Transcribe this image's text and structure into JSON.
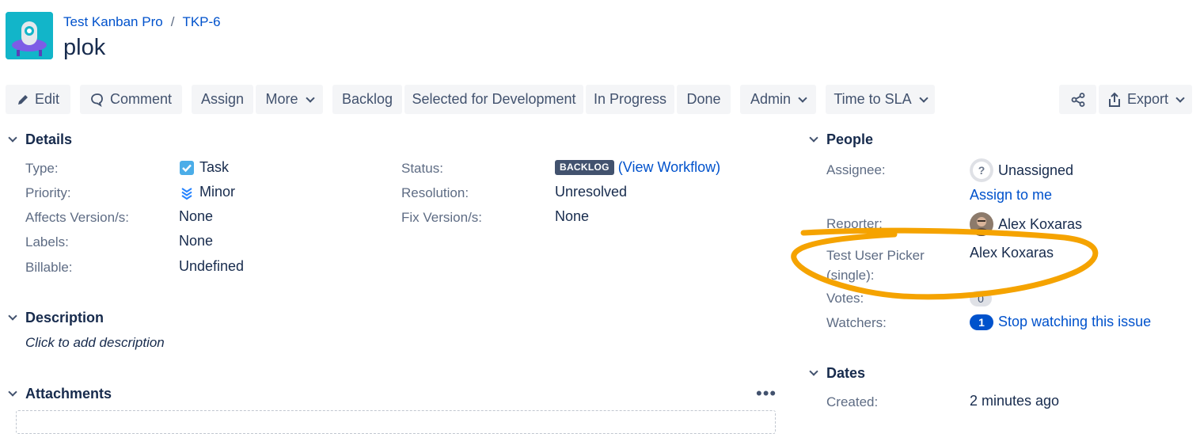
{
  "header": {
    "project_name": "Test Kanban Pro",
    "issue_key": "TKP-6",
    "breadcrumb_separator": "/",
    "title": "plok"
  },
  "toolbar": {
    "edit": "Edit",
    "comment": "Comment",
    "assign": "Assign",
    "more": "More",
    "backlog": "Backlog",
    "selected_for_development": "Selected for Development",
    "in_progress": "In Progress",
    "done": "Done",
    "admin": "Admin",
    "time_to_sla": "Time to SLA",
    "export": "Export"
  },
  "details": {
    "heading": "Details",
    "left": [
      {
        "label": "Type:",
        "value": "Task",
        "icon": "task-checkbox-icon"
      },
      {
        "label": "Priority:",
        "value": "Minor",
        "icon": "priority-minor-icon"
      },
      {
        "label": "Affects Version/s:",
        "value": "None"
      },
      {
        "label": "Labels:",
        "value": "None"
      },
      {
        "label": "Billable:",
        "value": "Undefined"
      }
    ],
    "right": [
      {
        "label": "Status:",
        "badge": "BACKLOG",
        "link": "(View Workflow)"
      },
      {
        "label": "Resolution:",
        "value": "Unresolved"
      },
      {
        "label": "Fix Version/s:",
        "value": "None"
      }
    ]
  },
  "description": {
    "heading": "Description",
    "placeholder": "Click to add description"
  },
  "attachments": {
    "heading": "Attachments",
    "menu": "•••"
  },
  "people": {
    "heading": "People",
    "assignee_label": "Assignee:",
    "assignee_value": "Unassigned",
    "assign_to_me": "Assign to me",
    "reporter_label": "Reporter:",
    "reporter_value": "Alex Koxaras",
    "user_picker_label": "Test User Picker (single):",
    "user_picker_value": "Alex Koxaras",
    "votes_label": "Votes:",
    "votes_value": "0",
    "watchers_label": "Watchers:",
    "watchers_count": "1",
    "watchers_link": "Stop watching this issue"
  },
  "dates": {
    "heading": "Dates",
    "created_label": "Created:",
    "created_value": "2 minutes ago"
  },
  "colors": {
    "link": "#0052cc",
    "status_badge": "#42526e",
    "annotation": "#f5a300",
    "project_avatar": "#12b5c9"
  }
}
